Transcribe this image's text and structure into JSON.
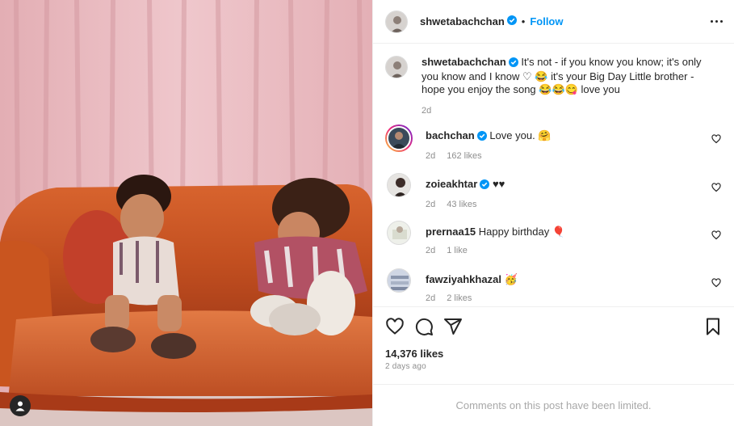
{
  "post": {
    "author": "shwetabachchan",
    "follow_label": "Follow",
    "separator": "•",
    "caption_text": "It's not - if you know you know; it's only you know and I know ♡ 😂 it's your Big Day Little brother - hope you enjoy the song 😂😂😋 love you",
    "caption_time": "2d",
    "likes": "14,376 likes",
    "posted_ago": "2 days ago",
    "comments_limited": "Comments on this post have been limited."
  },
  "comments": [
    {
      "user": "bachchan",
      "text": "Love you. 🤗",
      "time": "2d",
      "likes": "162 likes",
      "verified": true
    },
    {
      "user": "zoieakhtar",
      "text": "♥♥",
      "time": "2d",
      "likes": "43 likes",
      "verified": true
    },
    {
      "user": "prernaa15",
      "text": "Happy birthday 🎈",
      "time": "2d",
      "likes": "1 like",
      "verified": false
    },
    {
      "user": "fawziyahkhazal",
      "text": "🥳",
      "time": "2d",
      "likes": "2 likes",
      "verified": false
    }
  ],
  "colors": {
    "accent": "#0095f6",
    "verified": "#0095f6",
    "muted": "#8e8e8e"
  },
  "icons": [
    "user-tag-icon",
    "more-options-icon",
    "like-heart-icon",
    "comment-icon",
    "share-icon",
    "bookmark-icon",
    "verified-badge-icon"
  ]
}
